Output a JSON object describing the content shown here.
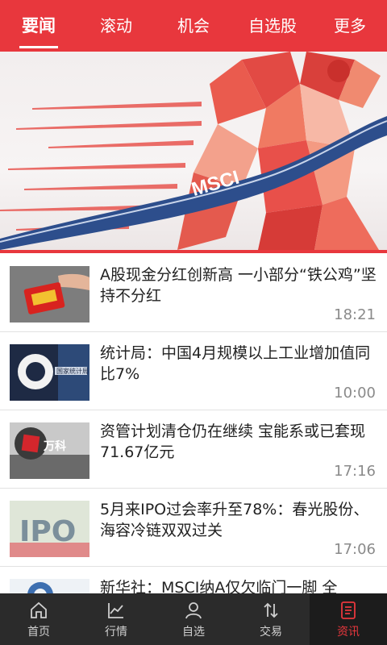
{
  "tabs": [
    {
      "label": "要闻",
      "active": true
    },
    {
      "label": "滚动",
      "active": false
    },
    {
      "label": "机会",
      "active": false
    },
    {
      "label": "自选股",
      "active": false
    },
    {
      "label": "更多",
      "active": false
    }
  ],
  "banner": {
    "ribbon_text": "MSCI"
  },
  "news": [
    {
      "title": "A股现金分红创新高 一小部分“铁公鸡”坚持不分红",
      "time": "18:21",
      "thumb_icon": "red-envelope-hand-icon"
    },
    {
      "title": "统计局：中国4月规模以上工业增加值同比7%",
      "time": "10:00",
      "thumb_icon": "statistics-bureau-building-icon"
    },
    {
      "title": "资管计划清仓仍在继续 宝能系或已套现71.67亿元",
      "time": "17:16",
      "thumb_icon": "vanke-logo-icon",
      "thumb_logo_text": "万科"
    },
    {
      "title": "5月来IPO过会率升至78%：春光股份、海容冷链双双过关",
      "time": "17:06",
      "thumb_icon": "ipo-letters-icon",
      "thumb_text": "IPO"
    },
    {
      "title": "新华社：MSCI纳A仅欠临门一脚 全",
      "time": "",
      "thumb_icon": "emblem-icon"
    }
  ],
  "bottom_nav": [
    {
      "label": "首页",
      "icon": "home-icon",
      "active": false
    },
    {
      "label": "行情",
      "icon": "market-chart-icon",
      "active": false
    },
    {
      "label": "自选",
      "icon": "person-icon",
      "active": false
    },
    {
      "label": "交易",
      "icon": "trade-arrows-icon",
      "active": false
    },
    {
      "label": "资讯",
      "icon": "news-document-icon",
      "active": true
    }
  ],
  "colors": {
    "accent": "#e8373d",
    "nav_bg": "#2b2b2b",
    "text": "#222222",
    "time": "#8a8a8a"
  }
}
